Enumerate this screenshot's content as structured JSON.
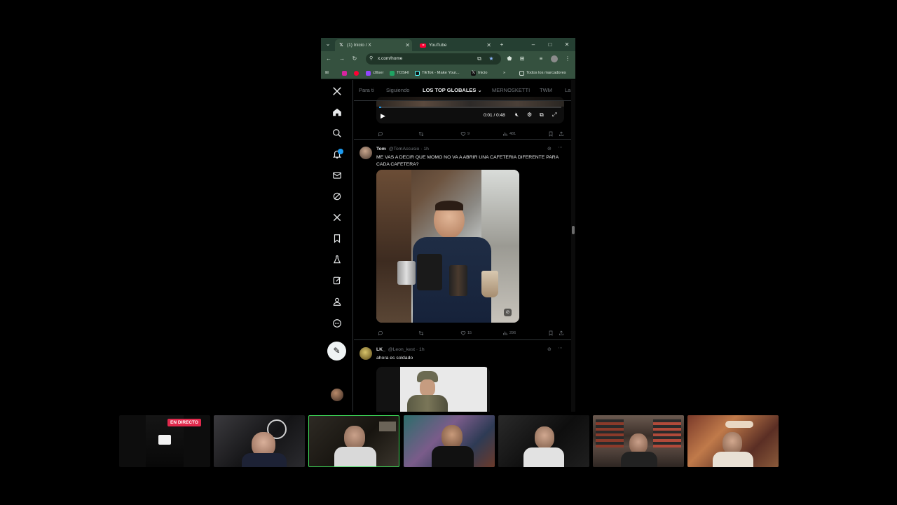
{
  "browser": {
    "tabs": [
      {
        "title": "(1) Inicio / X",
        "active": true,
        "icon": "x-logo-icon"
      },
      {
        "title": "YouTube",
        "active": false,
        "icon": "youtube-icon"
      }
    ],
    "new_tab": "+",
    "window_controls": {
      "minimize": "–",
      "maximize": "□",
      "close": "✕"
    },
    "url": "x.com/home",
    "bookmarks": [
      {
        "label": "",
        "icon": "instagram-icon",
        "color": "#d6249f"
      },
      {
        "label": "",
        "icon": "youtube-icon",
        "color": "#ff0033"
      },
      {
        "label": "c0lser",
        "icon": "twitch-icon",
        "color": "#9146ff"
      },
      {
        "label": "TOSHI",
        "icon": "sheets-icon",
        "color": "#1fa463"
      },
      {
        "label": "TikTok - Make Your...",
        "icon": "tiktok-icon",
        "color": "#111111"
      },
      {
        "label": "Inicio",
        "icon": "x-logo-icon",
        "color": "#111111"
      },
      {
        "label": "»",
        "icon": "",
        "color": ""
      },
      {
        "label": "Todos los marcadores",
        "icon": "folder-icon",
        "color": "#c9d6cd"
      }
    ]
  },
  "x": {
    "feed_tabs": [
      "Para ti",
      "Siguiendo",
      "LOS TOP GLOBALES",
      "MERNOSKETTI",
      "TWM",
      "La"
    ],
    "active_tab": "LOS TOP GLOBALES",
    "video": {
      "time": "0:01 / 0:48"
    },
    "first_tweet_actions": {
      "reply": "",
      "retweet": "",
      "like": "9",
      "views": "481"
    },
    "tweets": [
      {
        "name": "Tom",
        "handle": "@TomAccusio · 1h",
        "text": "ME VAS A DECIR QUE MOMO NO VA A ABRIR UNA CAFETERIA DIFERENTE PARA CADA CAFETERA?",
        "actions": {
          "reply": "",
          "retweet": "",
          "like": "15",
          "views": "296"
        }
      },
      {
        "name": "LK_",
        "handle": "@Leon_kest · 1h",
        "text": "ahora es soldado"
      }
    ]
  },
  "stream": {
    "live_badge": "EN DIRECTO",
    "colors": {
      "live": "#e0294c",
      "active_cam_border": "#3fdd5a"
    }
  }
}
